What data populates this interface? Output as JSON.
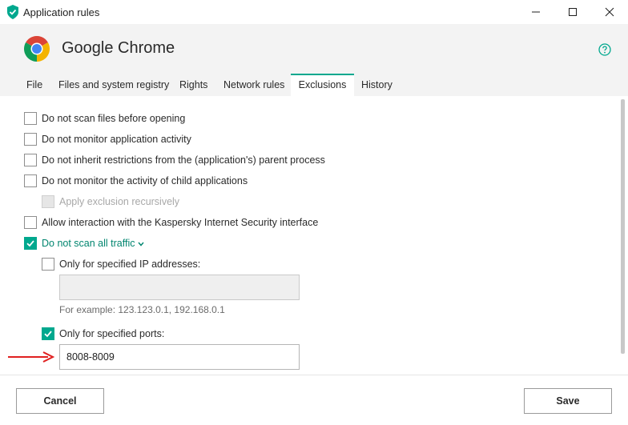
{
  "window": {
    "title": "Application rules"
  },
  "header": {
    "app_name": "Google Chrome"
  },
  "tabs": [
    {
      "label": "File"
    },
    {
      "label": "Files and system registry"
    },
    {
      "label": "Rights"
    },
    {
      "label": "Network rules"
    },
    {
      "label": "Exclusions"
    },
    {
      "label": "History"
    }
  ],
  "active_tab": "Exclusions",
  "options": {
    "no_scan_before_open": {
      "label": "Do not scan files before opening",
      "checked": false
    },
    "no_monitor_activity": {
      "label": "Do not monitor application activity",
      "checked": false
    },
    "no_inherit_restrictions": {
      "label": "Do not inherit restrictions from the (application's) parent process",
      "checked": false
    },
    "no_monitor_child": {
      "label": "Do not monitor the activity of child applications",
      "checked": false
    },
    "apply_recursively": {
      "label": "Apply exclusion recursively",
      "checked": false,
      "enabled": false
    },
    "allow_interaction": {
      "label": "Allow interaction with the Kaspersky Internet Security interface",
      "checked": false
    },
    "no_scan_traffic": {
      "label": "Do not scan all traffic",
      "checked": true
    },
    "only_ip": {
      "label": "Only for specified IP addresses:",
      "checked": false
    },
    "ip_field": {
      "value": "",
      "example": "For example: 123.123.0.1, 192.168.0.1"
    },
    "only_ports": {
      "label": "Only for specified ports:",
      "checked": true
    },
    "ports_field": {
      "value": "8008-8009"
    }
  },
  "footer": {
    "cancel_label": "Cancel",
    "save_label": "Save"
  },
  "colors": {
    "accent": "#00a88e",
    "annotation_arrow": "#e02020",
    "header_bg": "#f3f3f3"
  }
}
